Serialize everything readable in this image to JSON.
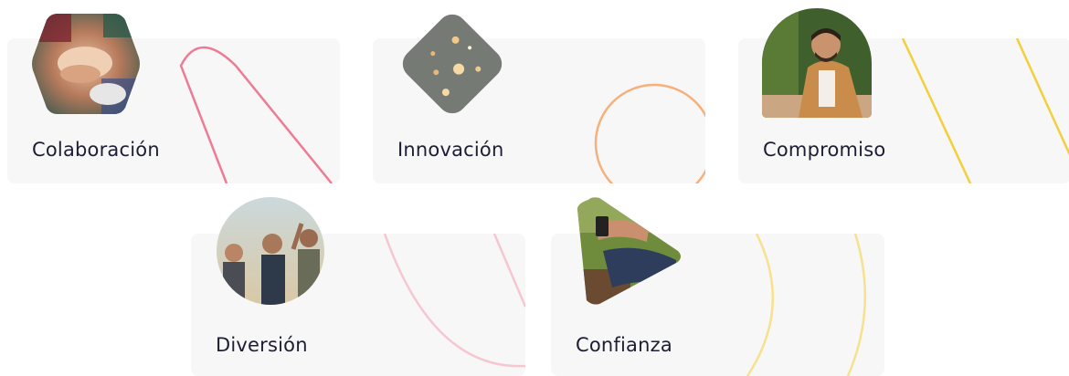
{
  "values": [
    {
      "title": "Colaboración",
      "image": "team-hands-photo",
      "line_color": "#ee7b95"
    },
    {
      "title": "Innovación",
      "image": "circuit-board-photo",
      "line_color": "#f5b07c"
    },
    {
      "title": "Compromiso",
      "image": "man-working-laptop-photo",
      "line_color": "#f2cf3d"
    },
    {
      "title": "Diversión",
      "image": "friends-celebrating-photo",
      "line_color": "#f6c6d1"
    },
    {
      "title": "Confianza",
      "image": "person-using-phone-photo",
      "line_color": "#f7e18e"
    }
  ]
}
